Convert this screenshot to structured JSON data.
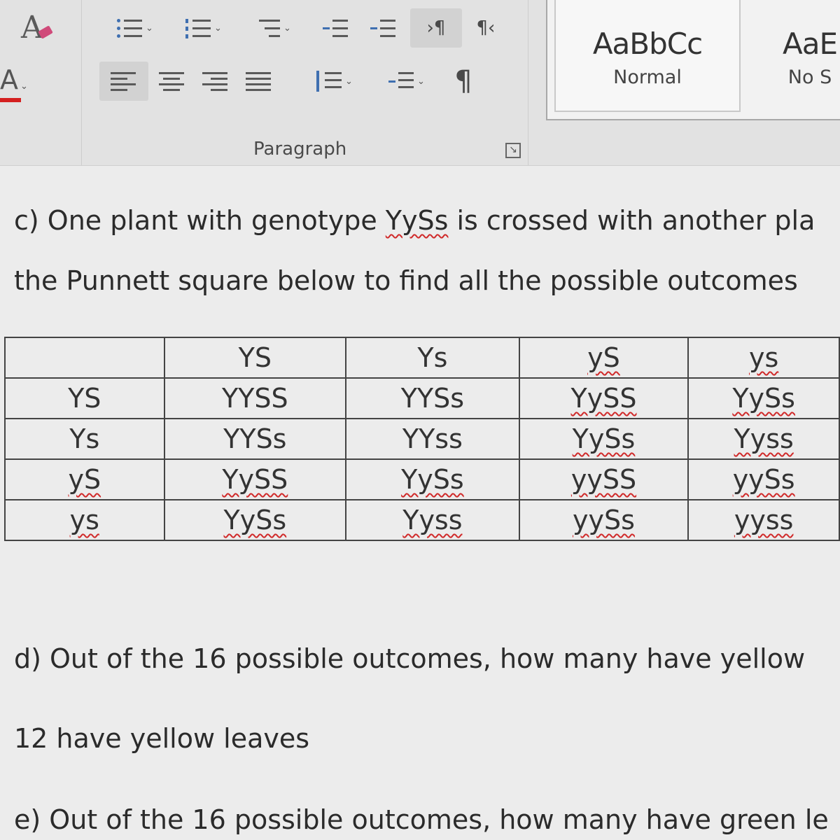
{
  "ribbon": {
    "paragraph_group_label": "Paragraph",
    "styles": [
      {
        "sample": "AaBbCc",
        "name": "Normal"
      },
      {
        "sample": "AaE",
        "name": "No S"
      }
    ],
    "icons": {
      "bullets": "bulleted-list-icon",
      "numbering": "numbered-list-icon",
      "multilevel": "multilevel-list-icon",
      "decrease_indent": "decrease-indent-icon",
      "increase_indent": "increase-indent-icon",
      "ltr": "left-to-right-icon",
      "rtl": "right-to-left-icon",
      "align_left": "align-left-icon",
      "center": "align-center-icon",
      "align_right": "align-right-icon",
      "justify": "justify-icon",
      "line_spacing": "line-spacing-icon",
      "shading": "shading-icon",
      "show_marks": "pilcrow-icon"
    }
  },
  "document": {
    "question_c_line1_prefix": "c) One plant with genotype ",
    "question_c_genotype": "YySs",
    "question_c_line1_suffix": " is crossed with another pla",
    "question_c_line2": "the Punnett square below to find all the possible outcomes",
    "question_d": "d) Out of the 16 possible outcomes, how many have yellow",
    "answer_d": "12 have yellow leaves",
    "question_e": "e) Out of the 16 possible outcomes, how many have green le"
  },
  "punnett": {
    "header": [
      "",
      "YS",
      "Ys",
      "yS",
      "ys"
    ],
    "rows": [
      [
        "YS",
        "YYSS",
        "YYSs",
        "YySS",
        "YySs"
      ],
      [
        "Ys",
        "YYSs",
        "YYss",
        "YySs",
        "Yyss"
      ],
      [
        "yS",
        "YySS",
        "YySs",
        "yySS",
        "yySs"
      ],
      [
        "ys",
        "YySs",
        "Yyss",
        "yySs",
        "yyss"
      ]
    ]
  }
}
